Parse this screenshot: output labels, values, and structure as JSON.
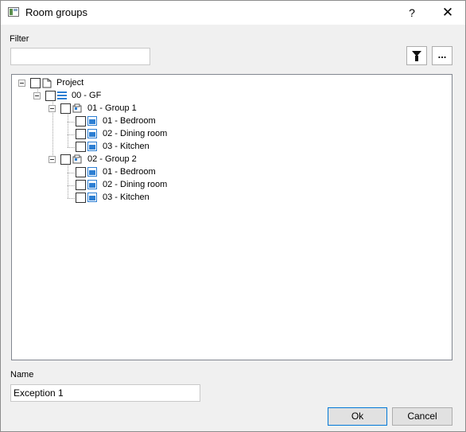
{
  "window": {
    "title": "Room groups",
    "help_label": "?",
    "close_label": "✕"
  },
  "filter": {
    "label": "Filter",
    "value": "",
    "placeholder": ""
  },
  "toolbar": {
    "filter_icon": "funnel-icon",
    "more_label": "..."
  },
  "tree": {
    "nodes": [
      {
        "label": "Project",
        "level": 0,
        "icon": "project-icon",
        "expanded": true,
        "checked": false
      },
      {
        "label": "00 - GF",
        "level": 1,
        "icon": "floor-list-icon",
        "expanded": true,
        "checked": false
      },
      {
        "label": "01 - Group 1",
        "level": 2,
        "icon": "room-group-icon",
        "expanded": true,
        "checked": false
      },
      {
        "label": "01 - Bedroom",
        "level": 3,
        "icon": "room-icon",
        "checked": false
      },
      {
        "label": "02 - Dining room",
        "level": 3,
        "icon": "room-icon",
        "checked": false
      },
      {
        "label": "03 - Kitchen",
        "level": 3,
        "icon": "room-icon",
        "checked": false
      },
      {
        "label": "02 - Group 2",
        "level": 2,
        "icon": "room-group-icon",
        "expanded": true,
        "checked": false
      },
      {
        "label": "01 - Bedroom",
        "level": 3,
        "icon": "room-icon",
        "checked": false
      },
      {
        "label": "02 - Dining room",
        "level": 3,
        "icon": "room-icon",
        "checked": false
      },
      {
        "label": "03 - Kitchen",
        "level": 3,
        "icon": "room-icon",
        "checked": false
      }
    ]
  },
  "name": {
    "label": "Name",
    "value": "Exception 1"
  },
  "buttons": {
    "ok": "Ok",
    "cancel": "Cancel"
  },
  "colors": {
    "accent": "#0078d7",
    "room_icon": "#2d7fd3"
  }
}
